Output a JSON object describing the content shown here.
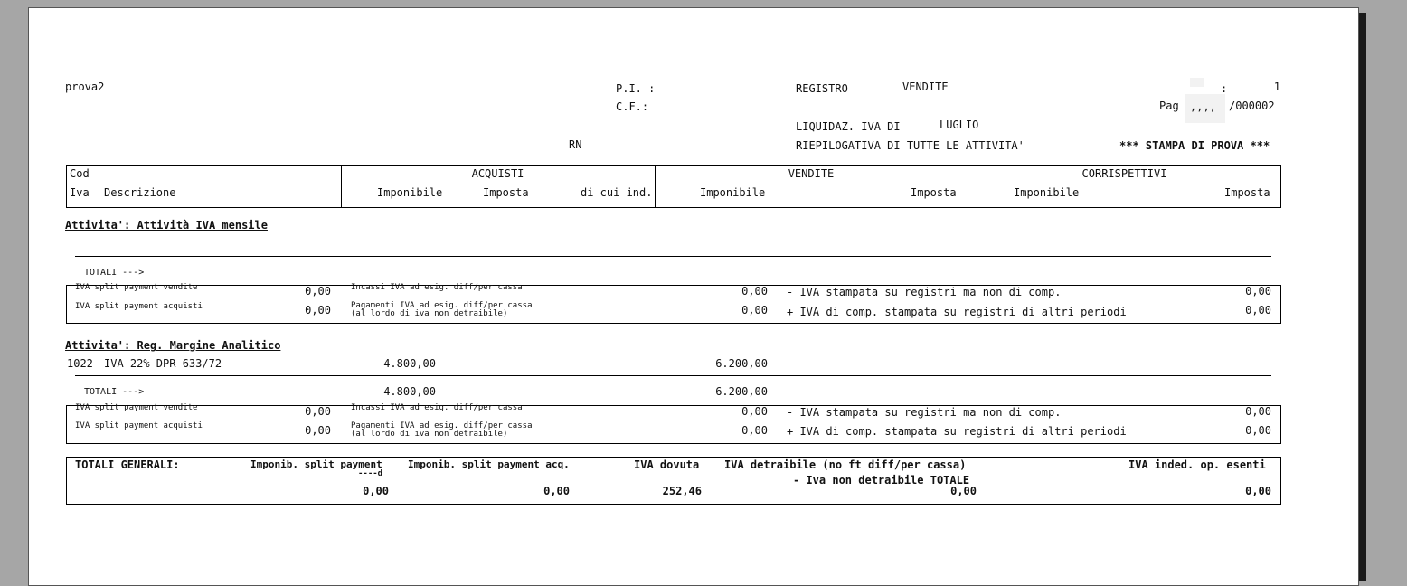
{
  "header": {
    "company": "prova2",
    "pi_label": "P.I. :",
    "cf_label": "C.F.:",
    "registro_label": "REGISTRO",
    "registro_value": "VENDITE",
    "num_label": ":",
    "num_value": "1",
    "pag_label": "Pag",
    "pag_partial": ",,,,",
    "pag_value": "/000002",
    "liquid_label": "LIQUIDAZ. IVA DI",
    "liquid_month": "LUGLIO",
    "rn": "RN",
    "riepilogativa": "RIEPILOGATIVA DI TUTTE LE ATTIVITA'",
    "stampa_prova": "*** STAMPA DI PROVA ***"
  },
  "columns": {
    "cod": "Cod",
    "iva": "Iva",
    "descrizione": "Descrizione",
    "acquisti": "ACQUISTI",
    "acq_imponibile": "Imponibile",
    "acq_imposta": "Imposta",
    "acq_dicui": "di cui ind.",
    "vendite": "VENDITE",
    "ven_imponibile": "Imponibile",
    "ven_imposta": "Imposta",
    "corrispettivi": "CORRISPETTIVI",
    "cor_imponibile": "Imponibile",
    "cor_imposta": "Imposta"
  },
  "sections": [
    {
      "title": "Attivita': Attività IVA mensile",
      "totali_label": "TOTALI --->",
      "totali_acq": "",
      "totali_ven": "",
      "split_vendite_label": "IVA split payment vendite",
      "split_vendite_value": "0,00",
      "split_acquisti_label": "IVA split payment acquisti",
      "split_acquisti_value": "0,00",
      "incassi_label": "Incassi IVA ad esig. diff/per cassa",
      "incassi_value": "0,00",
      "pagamenti_label": "Pagamenti IVA ad esig. diff/per cassa",
      "pagamenti_sub": "(al lordo di iva non detraibile)",
      "pagamenti_value": "0,00",
      "minus_label": "- IVA stampata su registri ma non di comp.",
      "minus_value": "0,00",
      "plus_label": "+ IVA di comp. stampata su registri di altri periodi",
      "plus_value": "0,00"
    },
    {
      "title": "Attivita': Reg. Margine Analitico",
      "row_code": "1022",
      "row_desc": "IVA 22% DPR 633/72",
      "row_acq": "4.800,00",
      "row_ven": "6.200,00",
      "totali_label": "TOTALI --->",
      "totali_acq": "4.800,00",
      "totali_ven": "6.200,00",
      "split_vendite_label": "IVA split payment vendite",
      "split_vendite_value": "0,00",
      "split_acquisti_label": "IVA split payment acquisti",
      "split_acquisti_value": "0,00",
      "incassi_label": "Incassi IVA ad esig. diff/per cassa",
      "incassi_value": "0,00",
      "pagamenti_label": "Pagamenti IVA ad esig. diff/per cassa",
      "pagamenti_sub": "(al lordo di iva non detraibile)",
      "pagamenti_value": "0,00",
      "minus_label": "- IVA stampata su registri ma non di comp.",
      "minus_value": "0,00",
      "plus_label": "+ IVA di comp. stampata su registri di altri periodi",
      "plus_value": "0,00"
    }
  ],
  "totali_generali": {
    "label": "TOTALI GENERALI:",
    "imponib_split_ven_label": "Imponib. split payment",
    "imponib_split_ven_cut": "----d",
    "imponib_split_acq_label": "Imponib. split payment acq.",
    "iva_dovuta_label": "IVA dovuta",
    "iva_detraibile_label": "IVA detraibile (no ft diff/per cassa)",
    "iva_non_detraibile_label": "- Iva non detraibile TOTALE",
    "iva_inded_label": "IVA inded. op. esenti",
    "imponib_split_ven_value": "0,00",
    "imponib_split_acq_value": "0,00",
    "iva_dovuta_value": "252,46",
    "iva_detraibile_value": "0,00",
    "iva_inded_value": "0,00"
  }
}
